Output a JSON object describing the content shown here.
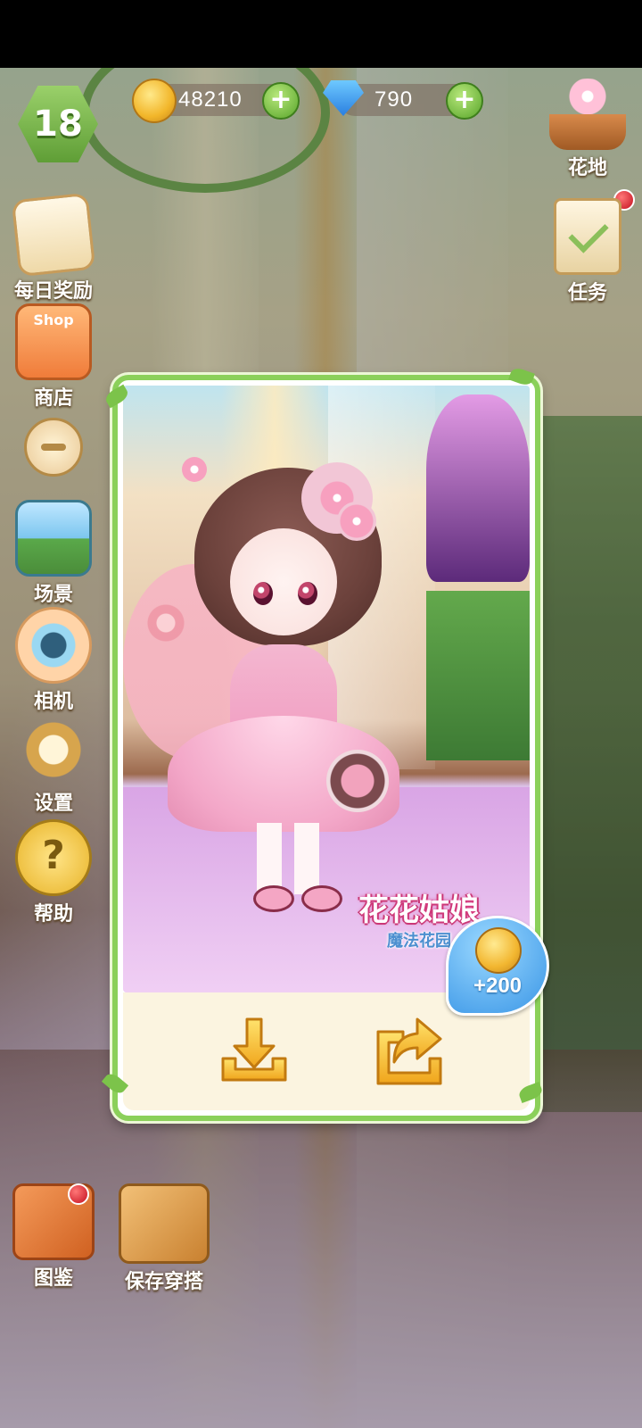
{
  "hud": {
    "level": "18",
    "coins": "48210",
    "gems": "790",
    "plus_symbol": "+"
  },
  "left_menu": [
    {
      "label": "每日奖励",
      "icon": "daily-reward-icon"
    },
    {
      "label": "商店",
      "icon": "shop-icon",
      "sign": "Shop"
    },
    {
      "label": "场景",
      "icon": "scene-icon"
    },
    {
      "label": "相机",
      "icon": "camera-icon"
    },
    {
      "label": "设置",
      "icon": "settings-icon"
    },
    {
      "label": "帮助",
      "icon": "help-icon"
    }
  ],
  "right_menu": [
    {
      "label": "花地",
      "icon": "flower-pot-icon"
    },
    {
      "label": "任务",
      "icon": "task-icon"
    }
  ],
  "bottom_menu": [
    {
      "label": "图鉴",
      "icon": "catalog-book-icon"
    },
    {
      "label": "保存穿搭",
      "icon": "save-outfit-icon"
    }
  ],
  "popup": {
    "logo_title": "花花姑娘",
    "logo_subtitle": "魔法花园",
    "reward": "+200",
    "download_icon": "download-icon",
    "share_icon": "share-icon"
  },
  "colors": {
    "frame_green": "#8bd05a",
    "panel_cream": "#fbf4e0",
    "button_gold": "#f4b52a",
    "bubble_blue": "#3a96e6"
  }
}
